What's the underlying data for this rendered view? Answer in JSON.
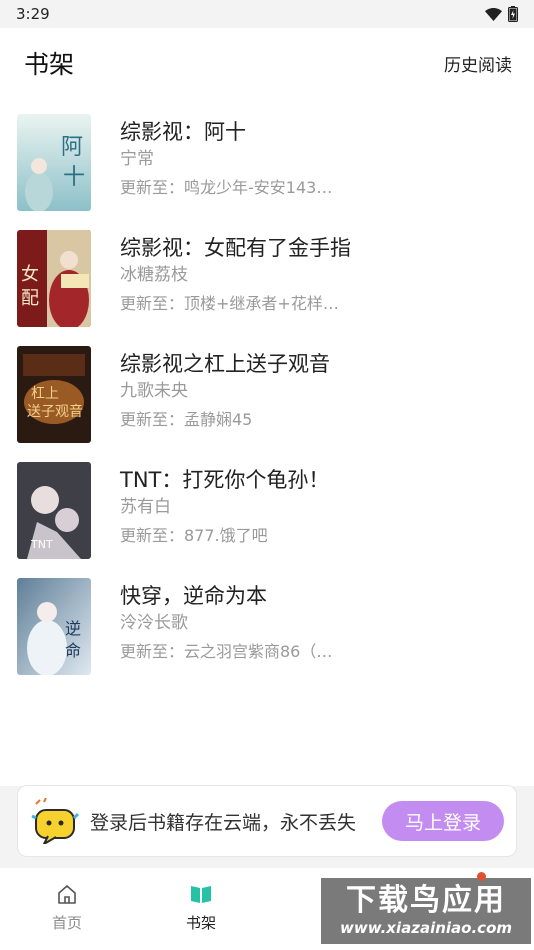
{
  "status_bar": {
    "time": "3:29",
    "wifi_icon": "wifi-icon",
    "battery_icon": "battery-charging-icon"
  },
  "header": {
    "title": "书架",
    "history_label": "历史阅读"
  },
  "books": [
    {
      "title": "综影视：阿十",
      "author": "宁常",
      "update": "更新至：鸣龙少年-安安143…",
      "cover_colors": [
        "#dfeee9",
        "#7fb7c4"
      ]
    },
    {
      "title": "综影视：女配有了金手指",
      "author": "冰糖荔枝",
      "update": "更新至：顶楼+继承者+花样…",
      "cover_colors": [
        "#8b1d1d",
        "#e9d7b0"
      ]
    },
    {
      "title": "综影视之杠上送子观音",
      "author": "九歌未央",
      "update": "更新至：孟静娴45",
      "cover_colors": [
        "#3a2418",
        "#c98a3c"
      ]
    },
    {
      "title": "TNT：打死你个龟孙！",
      "author": "苏有白",
      "update": "更新至：877.饿了吧",
      "cover_colors": [
        "#4a4a55",
        "#e7e3e8"
      ]
    },
    {
      "title": "快穿，逆命为本",
      "author": "泠泠长歌",
      "update": "更新至：云之羽宫紫商86（…",
      "cover_colors": [
        "#6f8fa8",
        "#e8eef4"
      ]
    }
  ],
  "login_banner": {
    "text": "登录后书籍存在云端，永不丢失",
    "button_label": "马上登录",
    "icon": "chat-mascot-icon"
  },
  "bottom_nav": [
    {
      "label": "首页",
      "icon": "home-icon"
    },
    {
      "label": "书架",
      "icon": "book-open-icon"
    }
  ],
  "watermark": {
    "main": "下载鸟应用",
    "url": "www.xiazainiao.com"
  },
  "colors": {
    "accent": "#c38cf0",
    "nav_active": "#26c1a6"
  }
}
